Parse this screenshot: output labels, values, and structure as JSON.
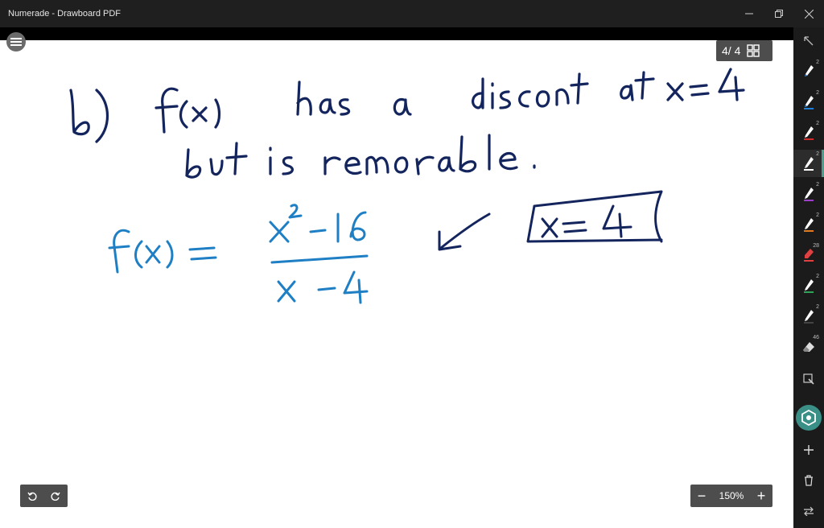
{
  "window": {
    "title": "Numerade - Drawboard PDF",
    "controls": {
      "minimize": "─",
      "restore": "❐",
      "close": "✕"
    }
  },
  "page_indicator": {
    "text": "4/ 4"
  },
  "zoom": {
    "value": "150%",
    "minus": "−",
    "plus": "+"
  },
  "sidebar": {
    "tools": [
      {
        "name": "pointer-tool"
      },
      {
        "name": "pen-blue-1",
        "badge": "2",
        "color": "#1f6fc2"
      },
      {
        "name": "pen-blue-2",
        "badge": "2",
        "color": "#1f7fd6"
      },
      {
        "name": "pen-red",
        "badge": "2",
        "color": "#d22b2b"
      },
      {
        "name": "pen-black-active",
        "badge": "2",
        "color": "#ffffff"
      },
      {
        "name": "pen-purple",
        "badge": "2",
        "color": "#9b3fc9"
      },
      {
        "name": "pen-orange",
        "badge": "2",
        "color": "#e07a1f"
      },
      {
        "name": "marker-red",
        "badge": "28",
        "color": "#e04040"
      },
      {
        "name": "pen-green",
        "badge": "2",
        "color": "#2fa35a"
      },
      {
        "name": "pen-dark",
        "badge": "2",
        "color": "#444444"
      },
      {
        "name": "eraser-tool",
        "badge": "46"
      },
      {
        "name": "select-tool"
      }
    ],
    "add_label": "+",
    "colors": {
      "accent": "#3a8f86"
    }
  },
  "handwriting": {
    "line1": "b) f(x) has a discont at x=4",
    "line2": "but is removable.",
    "equation_lhs": "f(x) =",
    "numerator": "x²-16",
    "denominator": "x - 4",
    "boxed": "x=4",
    "colors": {
      "navy": "#14255e",
      "blue": "#1f7fc4"
    }
  }
}
